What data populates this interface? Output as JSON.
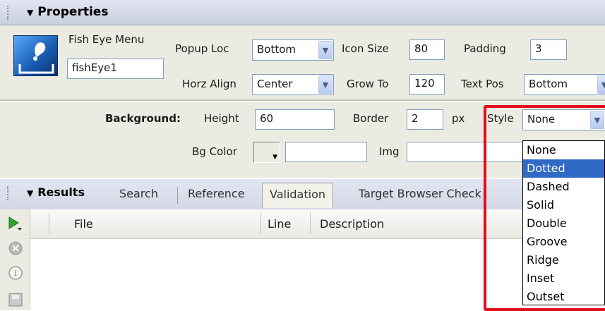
{
  "properties_panel": {
    "title": "Properties"
  },
  "widget": {
    "type_label": "Fish Eye Menu",
    "id_value": "fishEye1"
  },
  "fields": {
    "popup_loc": {
      "label": "Popup Loc",
      "value": "Bottom"
    },
    "icon_size": {
      "label": "Icon Size",
      "value": "80"
    },
    "padding": {
      "label": "Padding",
      "value": "3"
    },
    "horz_align": {
      "label": "Horz Align",
      "value": "Center"
    },
    "grow_to": {
      "label": "Grow To",
      "value": "120"
    },
    "text_pos": {
      "label": "Text Pos",
      "value": "Bottom"
    }
  },
  "background": {
    "section_label": "Background:",
    "height_label": "Height",
    "height_value": "60",
    "border_label": "Border",
    "border_value": "2",
    "border_unit": "px",
    "style_label": "Style",
    "style_value": "None",
    "bgcolor_label": "Bg Color",
    "bgcolor_value": "",
    "img_label": "Img",
    "img_value": ""
  },
  "style_dropdown": {
    "options": [
      "None",
      "Dotted",
      "Dashed",
      "Solid",
      "Double",
      "Groove",
      "Ridge",
      "Inset",
      "Outset"
    ],
    "highlighted": "Dotted"
  },
  "results_panel": {
    "title": "Results",
    "tabs": [
      "Search",
      "Reference",
      "Validation",
      "Target Browser Check"
    ],
    "active_tab": "Validation",
    "columns": [
      "File",
      "Line",
      "Description"
    ]
  },
  "colors": {
    "annotation": "#e20d1d",
    "highlight": "#316ac5",
    "panel_bg": "#ebebe2"
  }
}
